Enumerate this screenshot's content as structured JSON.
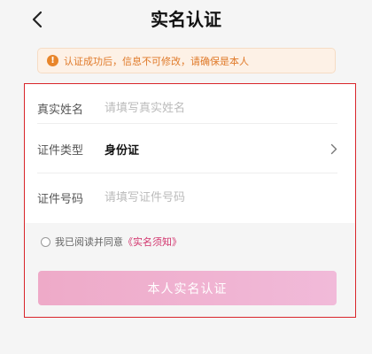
{
  "header": {
    "title": "实名认证",
    "back_icon": "chevron-left-icon"
  },
  "notice": {
    "icon": "info-icon",
    "icon_glyph": "!",
    "text": "认证成功后，信息不可修改，请确保是本人",
    "color": "#e07a2a"
  },
  "form": {
    "name": {
      "label": "真实姓名",
      "value": "",
      "placeholder": "请填写真实姓名"
    },
    "id_type": {
      "label": "证件类型",
      "value": "身份证",
      "icon": "chevron-right-icon"
    },
    "id_number": {
      "label": "证件号码",
      "value": "",
      "placeholder": "请填写证件号码"
    }
  },
  "agreement": {
    "text": "我已阅读并同意",
    "link": "《实名须知》",
    "checked": false,
    "link_color": "#d2336c"
  },
  "submit": {
    "label": "本人实名认证"
  }
}
